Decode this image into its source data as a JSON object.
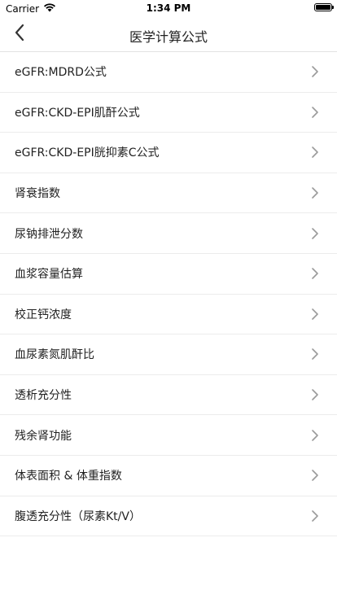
{
  "status_bar": {
    "carrier": "Carrier",
    "time": "1:34 PM",
    "battery_level": 1.0
  },
  "nav": {
    "title": "医学计算公式",
    "back_icon": "chevron-left-icon"
  },
  "items": [
    {
      "label": "eGFR:MDRD公式"
    },
    {
      "label": "eGFR:CKD-EPI肌酐公式"
    },
    {
      "label": "eGFR:CKD-EPI胱抑素C公式"
    },
    {
      "label": "肾衰指数"
    },
    {
      "label": "尿钠排泄分数"
    },
    {
      "label": "血浆容量估算"
    },
    {
      "label": "校正钙浓度"
    },
    {
      "label": "血尿素氮肌酐比"
    },
    {
      "label": "透析充分性"
    },
    {
      "label": "残余肾功能"
    },
    {
      "label": "体表面积 & 体重指数"
    },
    {
      "label": "腹透充分性（尿素Kt/V）"
    }
  ],
  "colors": {
    "text": "#222222",
    "chevron": "#9a9a9a",
    "separator": "#ececec"
  }
}
